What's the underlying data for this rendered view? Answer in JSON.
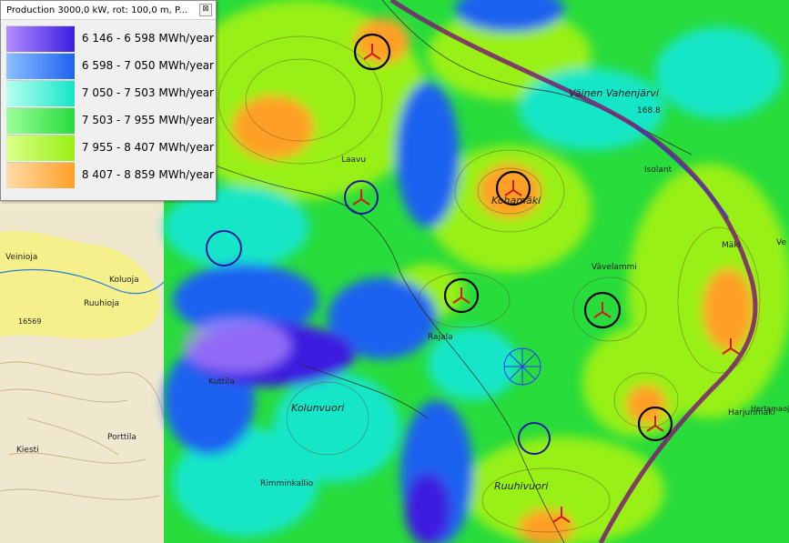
{
  "legend": {
    "title": "Production 3000,0 kW, rot: 100,0 m, P...",
    "close_label": "⊠",
    "items": [
      {
        "label": "6 146 - 6 598 MWh/year",
        "color_start": "#b48cff",
        "color_end": "#3c1ee0"
      },
      {
        "label": "6 598 - 7 050 MWh/year",
        "color_start": "#8cc0ff",
        "color_end": "#1e62f0"
      },
      {
        "label": "7 050 - 7 503 MWh/year",
        "color_start": "#b8fff0",
        "color_end": "#14e6c8"
      },
      {
        "label": "7 503 - 7 955 MWh/year",
        "color_start": "#9cff9c",
        "color_end": "#28dc3c"
      },
      {
        "label": "7 955 - 8 407 MWh/year",
        "color_start": "#dcff8c",
        "color_end": "#98f014"
      },
      {
        "label": "8 407 - 8 859 MWh/year",
        "color_start": "#ffdca8",
        "color_end": "#ffa028"
      }
    ]
  },
  "place_labels": [
    "Laavu",
    "Kohamäki",
    "Kolunvuori",
    "Ruuhivuori",
    "Väinen Vahenjärvi",
    "Isolant",
    "Veinioja",
    "Koluoja",
    "Ruuhioja",
    "Kiesti",
    "Porttila",
    "Rimminkallio",
    "Kuttila",
    "Vävelammi",
    "Mäki",
    "Harjunmäki",
    "Rajala",
    "168.8",
    "16569",
    "Hertamaoja",
    "Ve"
  ]
}
